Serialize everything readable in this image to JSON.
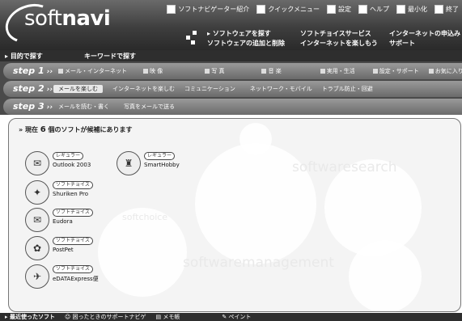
{
  "app": {
    "logo_light": "soft",
    "logo_bold": "navi"
  },
  "topmenu": [
    {
      "label": "ソフトナビゲーター紹介",
      "icon": "info-icon"
    },
    {
      "label": "クイックメニュー",
      "icon": "quick-menu-icon"
    },
    {
      "label": "設定",
      "icon": "settings-icon"
    },
    {
      "label": "ヘルプ",
      "icon": "help-icon"
    },
    {
      "label": "最小化",
      "icon": "minimize-icon"
    },
    {
      "label": "終了",
      "icon": "exit-icon"
    }
  ],
  "nav": {
    "find_software": "ソフトウェアを探す",
    "add_remove": "ソフトウェアの追加と削除",
    "softchoice": "ソフトチョイスサービス",
    "enjoy_internet": "インターネットを楽しもう",
    "internet_apply": "インターネットの申込み",
    "support": "サポート"
  },
  "modebar": {
    "by_purpose": "目的で探す",
    "by_keyword": "キーワードで探す"
  },
  "steps": {
    "step1": {
      "label": "step 1",
      "options": [
        "メール・インターネット",
        "映 像",
        "写 真",
        "音 楽",
        "実用・生活",
        "設定・サポート",
        "お気に入り"
      ],
      "selected": 0
    },
    "step2": {
      "label": "step 2",
      "options": [
        "メールを楽しむ",
        "インターネットを楽しむ",
        "コミュニケーション",
        "ネットワーク・モバイル",
        "トラブル防止・回避"
      ],
      "selected": 0
    },
    "step3": {
      "label": "step 3",
      "options": [
        "メールを読む・書く",
        "写真をメールで送る"
      ]
    }
  },
  "results": {
    "prefix": "現在",
    "count": "6",
    "suffix": "個のソフトが候補にあります",
    "watermarks": [
      "softwaresearch",
      "softchoice",
      "softwaremanagement"
    ],
    "items": [
      {
        "badge": "レギュラー",
        "name": "Outlook 2003",
        "icon": "outlook-icon",
        "glyph": "✉"
      },
      {
        "badge": "レギュラー",
        "name": "SmartHobby",
        "icon": "smarthobby-icon",
        "glyph": "♜"
      },
      {
        "badge": "ソフトチョイス",
        "name": "Shuriken Pro",
        "icon": "shuriken-icon",
        "glyph": "✦"
      },
      {
        "badge": "ソフトチョイス",
        "name": "Eudora",
        "icon": "eudora-icon",
        "glyph": "✉"
      },
      {
        "badge": "ソフトチョイス",
        "name": "PostPet",
        "icon": "postpet-icon",
        "glyph": "✿"
      },
      {
        "badge": "ソフトチョイス",
        "name": "eDATAExpress便",
        "icon": "edataexpress-icon",
        "glyph": "✈"
      }
    ]
  },
  "footer": {
    "recent": "最近使ったソフト",
    "trouble": "困ったときのサポートナビゲ",
    "memo": "メモ帳",
    "paint": "ペイント"
  }
}
